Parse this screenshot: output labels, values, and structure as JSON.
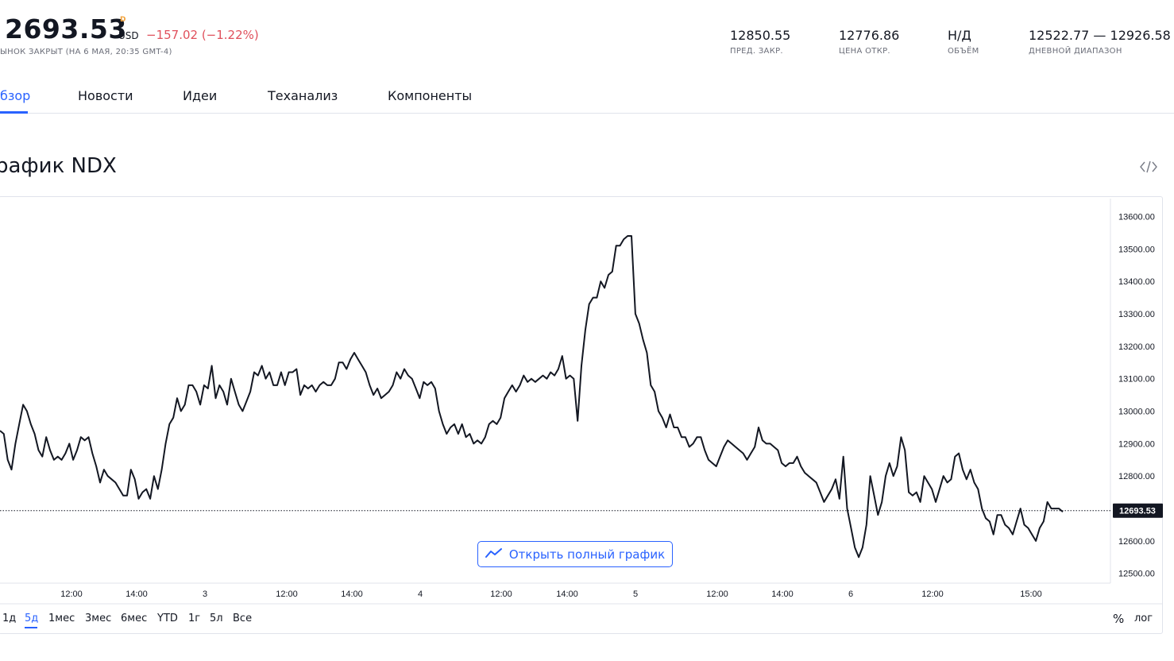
{
  "header": {
    "price": "2693.53",
    "price_suffix": "D",
    "currency": "USD",
    "change": "−157.02 (−1.22%)",
    "status": "ЫНОК ЗАКРЫТ (НА 6 МАЯ, 20:35 GMT-4)",
    "stats": [
      {
        "value": "12850.55",
        "label": "ПРЕД. ЗАКР."
      },
      {
        "value": "12776.86",
        "label": "ЦЕНА ОТКР."
      },
      {
        "value": "Н/Д",
        "label": "ОБЪЁМ"
      },
      {
        "value": "12522.77 — 12926.58",
        "label": "ДНЕВНОЙ ДИАПАЗОН"
      }
    ]
  },
  "tabs": [
    {
      "label": "бзор",
      "active": true
    },
    {
      "label": "Новости"
    },
    {
      "label": "Идеи"
    },
    {
      "label": "Теханализ"
    },
    {
      "label": "Компоненты"
    }
  ],
  "section_title": "рафик NDX",
  "chart_data": {
    "type": "line",
    "title": "",
    "xlabel": "",
    "ylabel": "",
    "x_ticks": [
      "12:00",
      "14:00",
      "3",
      "12:00",
      "14:00",
      "4",
      "12:00",
      "14:00",
      "5",
      "12:00",
      "14:00",
      "6",
      "12:00",
      "15:00"
    ],
    "y_ticks": [
      "12500.00",
      "12600.00",
      "12700.00",
      "12800.00",
      "12900.00",
      "13000.00",
      "13100.00",
      "13200.00",
      "13300.00",
      "13400.00",
      "13500.00",
      "13600.00"
    ],
    "ylim": [
      12470,
      13660
    ],
    "last_value": 12693.53,
    "last_value_label": "12693.53",
    "series": [
      {
        "values": [
          12940,
          12930,
          12850,
          12820,
          12900,
          12960,
          13020,
          13000,
          12960,
          12930,
          12880,
          12860,
          12920,
          12880,
          12850,
          12860,
          12850,
          12870,
          12900,
          12850,
          12880,
          12920,
          12910,
          12920,
          12870,
          12830,
          12780,
          12820,
          12800,
          12790,
          12780,
          12760,
          12740,
          12740,
          12820,
          12790,
          12730,
          12750,
          12760,
          12730,
          12800,
          12760,
          12820,
          12900,
          12960,
          12980,
          13040,
          13000,
          13020,
          13080,
          13080,
          13060,
          13020,
          13080,
          13070,
          13140,
          13040,
          13080,
          13060,
          13020,
          13100,
          13060,
          13020,
          13000,
          13030,
          13060,
          13120,
          13110,
          13140,
          13100,
          13120,
          13080,
          13080,
          13120,
          13080,
          13120,
          13120,
          13130,
          13050,
          13080,
          13070,
          13080,
          13060,
          13080,
          13090,
          13080,
          13080,
          13100,
          13150,
          13150,
          13130,
          13160,
          13180,
          13160,
          13140,
          13120,
          13080,
          13050,
          13070,
          13040,
          13050,
          13060,
          13080,
          13120,
          13100,
          13130,
          13110,
          13100,
          13070,
          13040,
          13090,
          13080,
          13090,
          13070,
          13000,
          12960,
          12930,
          12950,
          12960,
          12930,
          12960,
          12920,
          12930,
          12900,
          12910,
          12900,
          12920,
          12960,
          12970,
          12960,
          12980,
          13040,
          13060,
          13080,
          13060,
          13080,
          13110,
          13090,
          13100,
          13090,
          13100,
          13110,
          13100,
          13120,
          13110,
          13130,
          13170,
          13100,
          13110,
          13100,
          12970,
          13140,
          13250,
          13330,
          13350,
          13350,
          13400,
          13380,
          13420,
          13430,
          13510,
          13510,
          13530,
          13540,
          13540,
          13300,
          13270,
          13220,
          13180,
          13080,
          13060,
          13000,
          12980,
          12950,
          12990,
          12950,
          12950,
          12920,
          12920,
          12890,
          12900,
          12920,
          12920,
          12880,
          12850,
          12840,
          12830,
          12860,
          12890,
          12910,
          12900,
          12890,
          12880,
          12870,
          12850,
          12870,
          12890,
          12950,
          12910,
          12900,
          12900,
          12890,
          12880,
          12840,
          12830,
          12840,
          12840,
          12860,
          12830,
          12810,
          12800,
          12790,
          12780,
          12750,
          12720,
          12740,
          12760,
          12790,
          12730,
          12860,
          12700,
          12640,
          12580,
          12550,
          12580,
          12650,
          12800,
          12740,
          12680,
          12720,
          12800,
          12840,
          12800,
          12830,
          12920,
          12880,
          12750,
          12740,
          12750,
          12720,
          12800,
          12780,
          12760,
          12720,
          12760,
          12800,
          12780,
          12790,
          12860,
          12870,
          12820,
          12790,
          12820,
          12780,
          12760,
          12700,
          12670,
          12660,
          12620,
          12680,
          12680,
          12650,
          12640,
          12620,
          12660,
          12700,
          12650,
          12640,
          12620,
          12600,
          12640,
          12660,
          12720,
          12700,
          12700,
          12700,
          12690
        ]
      }
    ]
  },
  "open_full_chart_label": "Открыть полный график",
  "ranges": [
    "1д",
    "5д",
    "1мес",
    "3мес",
    "6мес",
    "YTD",
    "1г",
    "5л",
    "Все"
  ],
  "active_range": "5д",
  "scale_percent_label": "%",
  "scale_log_label": "лог",
  "colors": {
    "accent": "#2962ff",
    "negative": "#e0505c",
    "suffix": "#f2a23b",
    "line": "#131722"
  }
}
